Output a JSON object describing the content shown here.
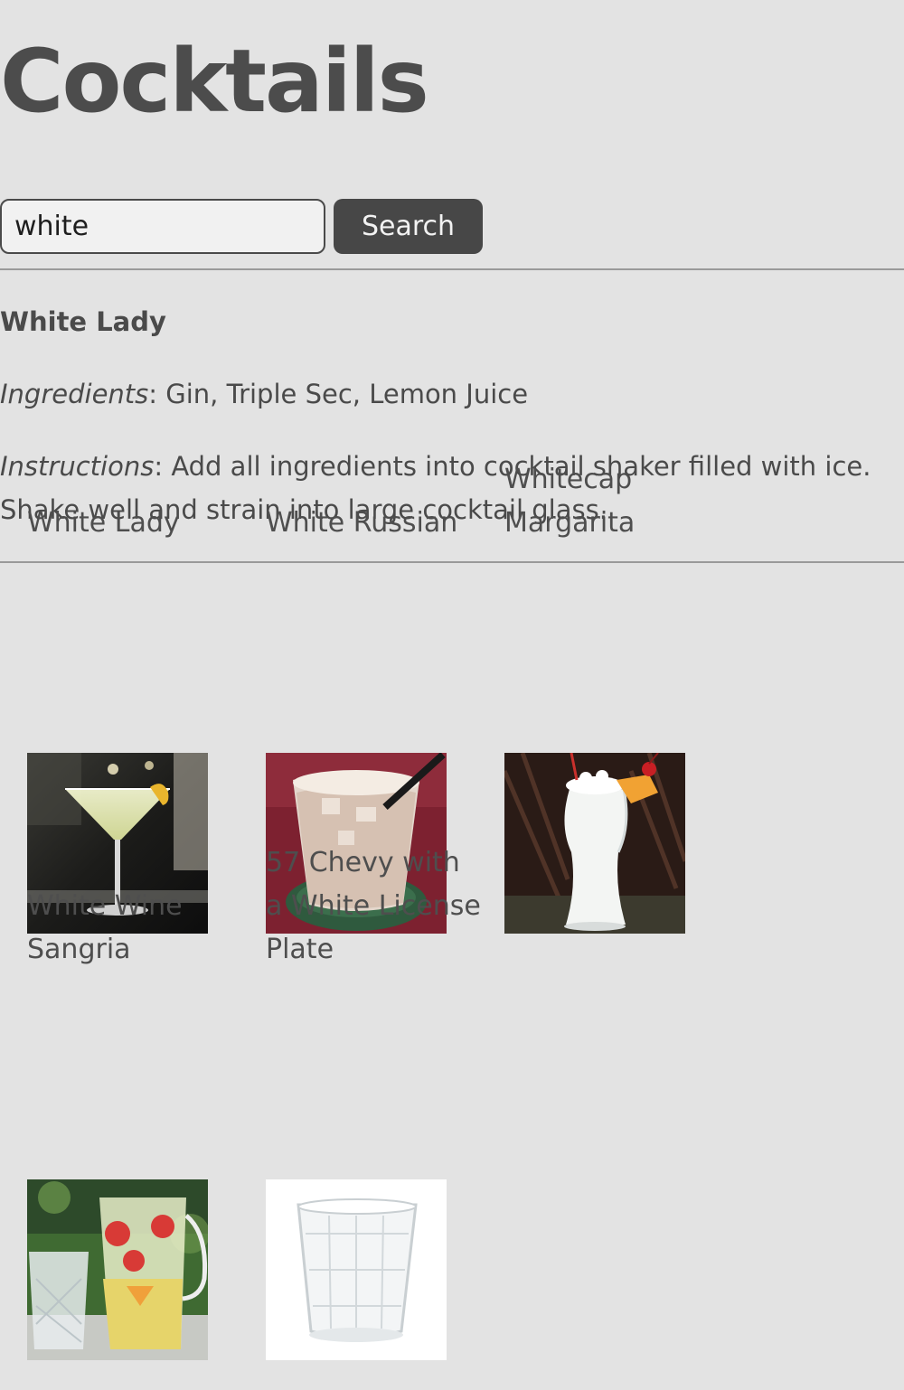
{
  "page": {
    "title": "Cocktails"
  },
  "search": {
    "value": "white",
    "button_label": "Search"
  },
  "detail": {
    "name": "White Lady",
    "ingredients_label": "Ingredients",
    "ingredients_text": ": Gin, Triple Sec, Lemon Juice",
    "instructions_label": "Instructions",
    "instructions_text": ": Add all ingredients into cocktail shaker filled with ice. Shake well and strain into large cocktail glass."
  },
  "results": [
    {
      "name": "White Lady",
      "image": "white-lady-photo"
    },
    {
      "name": "White Russian",
      "image": "white-russian-photo"
    },
    {
      "name": "Whitecap Margarita",
      "image": "whitecap-margarita-photo"
    },
    {
      "name": "White Wine Sangria",
      "image": "white-wine-sangria-photo"
    },
    {
      "name": "57 Chevy with a White License Plate",
      "image": "57-chevy-photo"
    }
  ]
}
